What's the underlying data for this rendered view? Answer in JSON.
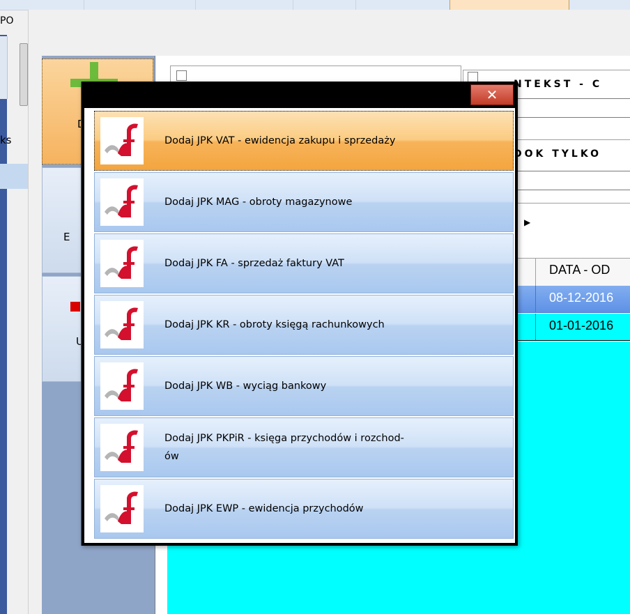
{
  "app": {
    "title_fragment": "PO",
    "left_fragment": "ks"
  },
  "nav": {
    "buttons": [
      {
        "letter": "D"
      },
      {
        "letter": "E"
      },
      {
        "letter": "U"
      }
    ]
  },
  "filters": {
    "group1_title": "NTEKST - C",
    "group2_title": "DOK TYLKO"
  },
  "grid": {
    "column_header": "DATA - OD",
    "rows": [
      {
        "value": "08-12-2016"
      },
      {
        "value": "01-01-2016"
      }
    ]
  },
  "dialog": {
    "close_symbol": "✕",
    "icon": "mf-logo-icon",
    "items": [
      {
        "label": "Dodaj JPK VAT - ewidencja zakupu i sprzedaży"
      },
      {
        "label": "Dodaj JPK MAG - obroty magazynowe"
      },
      {
        "label": "Dodaj JPK FA - sprzedaż faktury VAT"
      },
      {
        "label": "Dodaj JPK KR - obroty księgą rachunkowych"
      },
      {
        "label": "Dodaj JPK WB - wyciąg bankowy"
      },
      {
        "label": "Dodaj JPK PKPiR - księga przychodów i rozchod-\nów"
      },
      {
        "label": "Dodaj JPK EWP - ewidencja przychodów"
      }
    ]
  },
  "colors": {
    "accent_orange": "#f6b35f",
    "item_blue": "#b9d2f1",
    "grid_cyan": "#00ffff",
    "selected_row": "#6e9fea",
    "logo_red": "#d3102d",
    "close_red": "#c23b27"
  }
}
